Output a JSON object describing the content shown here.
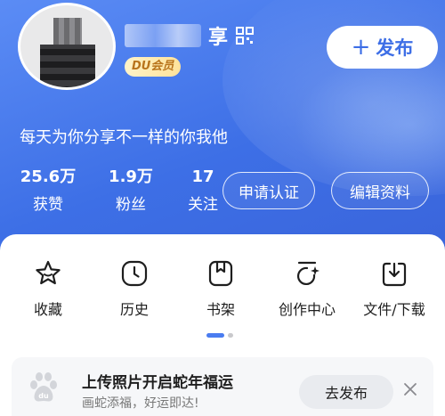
{
  "profile": {
    "name_suffix": "享",
    "badge": "DU会员",
    "bio": "每天为你分享不一样的你我他"
  },
  "header": {
    "publish_label": "发布",
    "publish_icon": "plus-icon",
    "qr_icon": "qr-code-icon"
  },
  "stats": [
    {
      "value": "25.6万",
      "label": "获赞"
    },
    {
      "value": "1.9万",
      "label": "粉丝"
    },
    {
      "value": "17",
      "label": "关注"
    }
  ],
  "actions": {
    "verify_label": "申请认证",
    "edit_label": "编辑资料"
  },
  "tools": [
    {
      "label": "收藏",
      "icon": "star-icon"
    },
    {
      "label": "历史",
      "icon": "clock-icon"
    },
    {
      "label": "书架",
      "icon": "bookshelf-icon"
    },
    {
      "label": "创作中心",
      "icon": "creator-center-icon"
    },
    {
      "label": "文件/下载",
      "icon": "download-icon"
    }
  ],
  "pager": {
    "pages": 2,
    "current": 1
  },
  "banner": {
    "title": "上传照片开启蛇年福运",
    "subtitle": "画蛇添福，好运即达!",
    "button_label": "去发布",
    "icon": "baidu-paw-icon"
  },
  "colors": {
    "accent": "#4a7cf0",
    "vip_text": "#b8741c"
  }
}
